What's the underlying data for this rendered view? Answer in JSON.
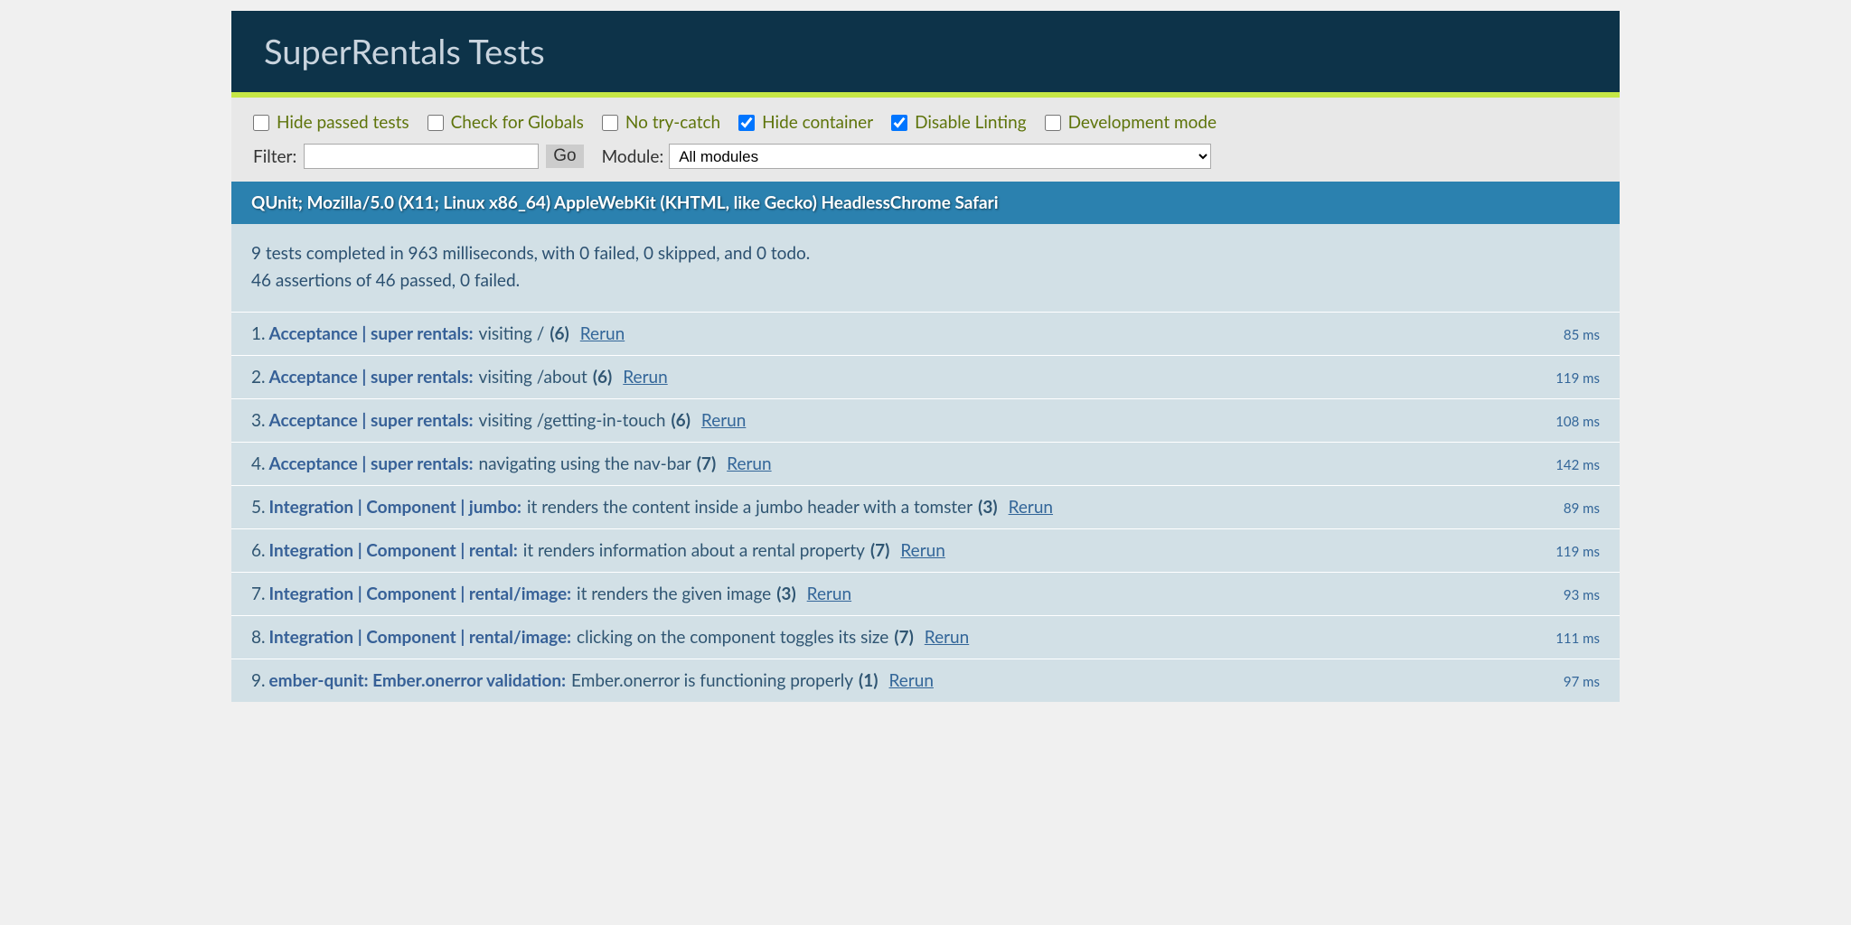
{
  "header": {
    "title": "SuperRentals Tests"
  },
  "toolbar": {
    "checkboxes": [
      {
        "label": "Hide passed tests",
        "checked": false
      },
      {
        "label": "Check for Globals",
        "checked": false
      },
      {
        "label": "No try-catch",
        "checked": false
      },
      {
        "label": "Hide container",
        "checked": true
      },
      {
        "label": "Disable Linting",
        "checked": true
      },
      {
        "label": "Development mode",
        "checked": false
      }
    ],
    "filter_label": "Filter:",
    "filter_value": "",
    "go_label": "Go",
    "module_label": "Module:",
    "module_selected": "All modules"
  },
  "user_agent": "QUnit; Mozilla/5.0 (X11; Linux x86_64) AppleWebKit (KHTML, like Gecko) HeadlessChrome Safari",
  "summary": {
    "line1": "9 tests completed in 963 milliseconds, with 0 failed, 0 skipped, and 0 todo.",
    "line2": "46 assertions of 46 passed, 0 failed."
  },
  "rerun_label": "Rerun",
  "tests": [
    {
      "num": "1.",
      "module": "Acceptance | super rentals:",
      "name": "visiting /",
      "count": "(6)",
      "time": "85 ms"
    },
    {
      "num": "2.",
      "module": "Acceptance | super rentals:",
      "name": "visiting /about",
      "count": "(6)",
      "time": "119 ms"
    },
    {
      "num": "3.",
      "module": "Acceptance | super rentals:",
      "name": "visiting /getting-in-touch",
      "count": "(6)",
      "time": "108 ms"
    },
    {
      "num": "4.",
      "module": "Acceptance | super rentals:",
      "name": "navigating using the nav-bar",
      "count": "(7)",
      "time": "142 ms"
    },
    {
      "num": "5.",
      "module": "Integration | Component | jumbo:",
      "name": "it renders the content inside a jumbo header with a tomster",
      "count": "(3)",
      "time": "89 ms"
    },
    {
      "num": "6.",
      "module": "Integration | Component | rental:",
      "name": "it renders information about a rental property",
      "count": "(7)",
      "time": "119 ms"
    },
    {
      "num": "7.",
      "module": "Integration | Component | rental/image:",
      "name": "it renders the given image",
      "count": "(3)",
      "time": "93 ms"
    },
    {
      "num": "8.",
      "module": "Integration | Component | rental/image:",
      "name": "clicking on the component toggles its size",
      "count": "(7)",
      "time": "111 ms"
    },
    {
      "num": "9.",
      "module": "ember-qunit: Ember.onerror validation:",
      "name": "Ember.onerror is functioning properly",
      "count": "(1)",
      "time": "97 ms"
    }
  ]
}
